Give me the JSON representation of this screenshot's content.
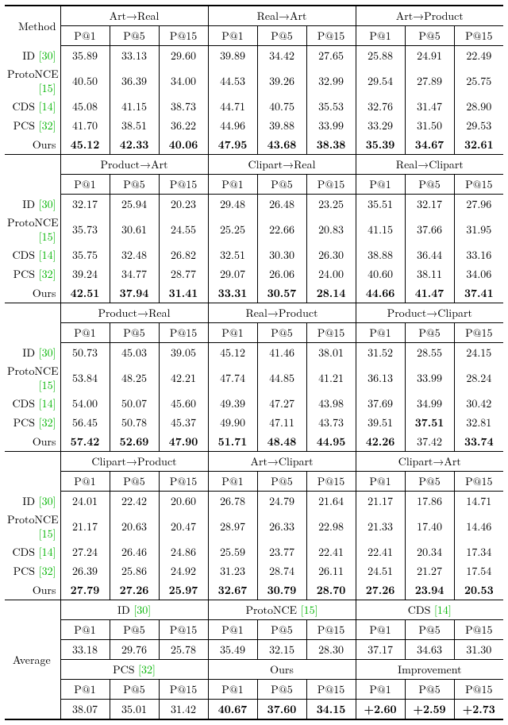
{
  "chart_data": {
    "type": "table",
    "title": "Cross-domain retrieval P@K results",
    "methods": [
      "ID [30]",
      "ProtoNCE [15]",
      "CDS [14]",
      "PCS [32]",
      "Ours"
    ],
    "metrics": [
      "P@1",
      "P@5",
      "P@15"
    ],
    "tasks": {
      "Art→Real": {
        "ID": [
          35.89,
          33.13,
          29.6
        ],
        "ProtoNCE": [
          40.5,
          36.39,
          34.0
        ],
        "CDS": [
          45.08,
          41.15,
          38.73
        ],
        "PCS": [
          41.7,
          38.51,
          36.22
        ],
        "Ours": [
          45.12,
          42.33,
          40.06
        ]
      },
      "Real→Art": {
        "ID": [
          39.89,
          34.42,
          27.65
        ],
        "ProtoNCE": [
          44.53,
          39.26,
          32.99
        ],
        "CDS": [
          44.71,
          40.75,
          35.53
        ],
        "PCS": [
          44.96,
          39.88,
          33.99
        ],
        "Ours": [
          47.95,
          43.68,
          38.38
        ]
      },
      "Art→Product": {
        "ID": [
          25.88,
          24.91,
          22.49
        ],
        "ProtoNCE": [
          29.54,
          27.89,
          25.75
        ],
        "CDS": [
          32.76,
          31.47,
          28.9
        ],
        "PCS": [
          33.29,
          31.5,
          29.53
        ],
        "Ours": [
          35.39,
          34.67,
          32.61
        ]
      },
      "Product→Art": {
        "ID": [
          32.17,
          25.94,
          20.23
        ],
        "ProtoNCE": [
          35.73,
          30.61,
          24.55
        ],
        "CDS": [
          35.75,
          32.48,
          26.82
        ],
        "PCS": [
          39.24,
          34.77,
          28.77
        ],
        "Ours": [
          42.51,
          37.94,
          31.41
        ]
      },
      "Clipart→Real": {
        "ID": [
          29.48,
          26.48,
          23.25
        ],
        "ProtoNCE": [
          25.25,
          22.66,
          20.83
        ],
        "CDS": [
          32.51,
          30.3,
          26.3
        ],
        "PCS": [
          29.07,
          26.06,
          24.0
        ],
        "Ours": [
          33.31,
          30.57,
          28.14
        ]
      },
      "Real→Clipart": {
        "ID": [
          35.51,
          32.17,
          27.96
        ],
        "ProtoNCE": [
          41.15,
          37.66,
          31.95
        ],
        "CDS": [
          38.88,
          36.44,
          33.16
        ],
        "PCS": [
          40.6,
          38.11,
          34.06
        ],
        "Ours": [
          44.66,
          41.47,
          37.41
        ]
      },
      "Product→Real": {
        "ID": [
          50.73,
          45.03,
          39.05
        ],
        "ProtoNCE": [
          53.84,
          48.25,
          42.21
        ],
        "CDS": [
          54.0,
          50.07,
          45.6
        ],
        "PCS": [
          56.45,
          50.78,
          45.37
        ],
        "Ours": [
          57.42,
          52.69,
          47.9
        ]
      },
      "Real→Product": {
        "ID": [
          45.12,
          41.46,
          38.01
        ],
        "ProtoNCE": [
          47.74,
          44.85,
          41.21
        ],
        "CDS": [
          49.39,
          47.27,
          43.98
        ],
        "PCS": [
          49.9,
          47.11,
          43.73
        ],
        "Ours": [
          51.71,
          48.48,
          44.95
        ]
      },
      "Product→Clipart": {
        "ID": [
          31.52,
          28.55,
          24.15
        ],
        "ProtoNCE": [
          36.13,
          33.99,
          28.24
        ],
        "CDS": [
          37.69,
          34.99,
          30.42
        ],
        "PCS": [
          39.51,
          37.51,
          32.81
        ],
        "Ours": [
          42.26,
          37.42,
          33.74
        ]
      },
      "Clipart→Product": {
        "ID": [
          24.01,
          22.42,
          20.6
        ],
        "ProtoNCE": [
          21.17,
          20.63,
          20.47
        ],
        "CDS": [
          27.24,
          26.46,
          24.86
        ],
        "PCS": [
          26.39,
          25.86,
          24.92
        ],
        "Ours": [
          27.79,
          27.26,
          25.97
        ]
      },
      "Art→Clipart": {
        "ID": [
          26.78,
          24.79,
          21.64
        ],
        "ProtoNCE": [
          28.97,
          26.33,
          22.98
        ],
        "CDS": [
          25.59,
          23.77,
          22.41
        ],
        "PCS": [
          31.23,
          28.74,
          26.11
        ],
        "Ours": [
          32.67,
          30.79,
          28.7
        ]
      },
      "Clipart→Art": {
        "ID": [
          21.17,
          17.86,
          14.71
        ],
        "ProtoNCE": [
          21.33,
          17.4,
          14.46
        ],
        "CDS": [
          22.41,
          20.34,
          17.34
        ],
        "PCS": [
          24.51,
          21.27,
          17.54
        ],
        "Ours": [
          27.26,
          23.94,
          20.53
        ]
      }
    },
    "averages": {
      "ID": [
        33.18,
        29.76,
        25.78
      ],
      "ProtoNCE": [
        35.49,
        32.15,
        28.3
      ],
      "CDS": [
        37.17,
        34.63,
        31.3
      ],
      "PCS": [
        38.07,
        35.01,
        31.42
      ],
      "Ours": [
        40.67,
        37.6,
        34.15
      ],
      "Improvement": [
        "+2.60",
        "+2.59",
        "+2.73"
      ]
    }
  },
  "hdr": {
    "method": "Method",
    "p1": "P@1",
    "p5": "P@5",
    "p15": "P@15",
    "avg": "Average",
    "improvement": "Improvement",
    "task1a": "Art→Real",
    "task1b": "Real→Art",
    "task1c": "Art→Product",
    "task2a": "Product→Art",
    "task2b": "Clipart→Real",
    "task2c": "Real→Clipart",
    "task3a": "Product→Real",
    "task3b": "Real→Product",
    "task3c": "Product→Clipart",
    "task4a": "Clipart→Product",
    "task4b": "Art→Clipart",
    "task4c": "Clipart→Art"
  },
  "m": {
    "id": {
      "name": "ID ",
      "ref": "[30]"
    },
    "pn": {
      "name": "ProtoNCE ",
      "ref": "[15]"
    },
    "cds": {
      "name": "CDS ",
      "ref": "[14]"
    },
    "pcs": {
      "name": "PCS ",
      "ref": "[32]"
    },
    "ours": {
      "name": "Ours"
    }
  },
  "b1": {
    "id": {
      "a1": "35.89",
      "a2": "33.13",
      "a3": "29.60",
      "b1": "39.89",
      "b2": "34.42",
      "b3": "27.65",
      "c1": "25.88",
      "c2": "24.91",
      "c3": "22.49"
    },
    "pn": {
      "a1": "40.50",
      "a2": "36.39",
      "a3": "34.00",
      "b1": "44.53",
      "b2": "39.26",
      "b3": "32.99",
      "c1": "29.54",
      "c2": "27.89",
      "c3": "25.75"
    },
    "cds": {
      "a1": "45.08",
      "a2": "41.15",
      "a3": "38.73",
      "b1": "44.71",
      "b2": "40.75",
      "b3": "35.53",
      "c1": "32.76",
      "c2": "31.47",
      "c3": "28.90"
    },
    "pcs": {
      "a1": "41.70",
      "a2": "38.51",
      "a3": "36.22",
      "b1": "44.96",
      "b2": "39.88",
      "b3": "33.99",
      "c1": "33.29",
      "c2": "31.50",
      "c3": "29.53"
    },
    "ours": {
      "a1": "45.12",
      "a2": "42.33",
      "a3": "40.06",
      "b1": "47.95",
      "b2": "43.68",
      "b3": "38.38",
      "c1": "35.39",
      "c2": "34.67",
      "c3": "32.61"
    }
  },
  "b2": {
    "id": {
      "a1": "32.17",
      "a2": "25.94",
      "a3": "20.23",
      "b1": "29.48",
      "b2": "26.48",
      "b3": "23.25",
      "c1": "35.51",
      "c2": "32.17",
      "c3": "27.96"
    },
    "pn": {
      "a1": "35.73",
      "a2": "30.61",
      "a3": "24.55",
      "b1": "25.25",
      "b2": "22.66",
      "b3": "20.83",
      "c1": "41.15",
      "c2": "37.66",
      "c3": "31.95"
    },
    "cds": {
      "a1": "35.75",
      "a2": "32.48",
      "a3": "26.82",
      "b1": "32.51",
      "b2": "30.30",
      "b3": "26.30",
      "c1": "38.88",
      "c2": "36.44",
      "c3": "33.16"
    },
    "pcs": {
      "a1": "39.24",
      "a2": "34.77",
      "a3": "28.77",
      "b1": "29.07",
      "b2": "26.06",
      "b3": "24.00",
      "c1": "40.60",
      "c2": "38.11",
      "c3": "34.06"
    },
    "ours": {
      "a1": "42.51",
      "a2": "37.94",
      "a3": "31.41",
      "b1": "33.31",
      "b2": "30.57",
      "b3": "28.14",
      "c1": "44.66",
      "c2": "41.47",
      "c3": "37.41"
    }
  },
  "b3": {
    "id": {
      "a1": "50.73",
      "a2": "45.03",
      "a3": "39.05",
      "b1": "45.12",
      "b2": "41.46",
      "b3": "38.01",
      "c1": "31.52",
      "c2": "28.55",
      "c3": "24.15"
    },
    "pn": {
      "a1": "53.84",
      "a2": "48.25",
      "a3": "42.21",
      "b1": "47.74",
      "b2": "44.85",
      "b3": "41.21",
      "c1": "36.13",
      "c2": "33.99",
      "c3": "28.24"
    },
    "cds": {
      "a1": "54.00",
      "a2": "50.07",
      "a3": "45.60",
      "b1": "49.39",
      "b2": "47.27",
      "b3": "43.98",
      "c1": "37.69",
      "c2": "34.99",
      "c3": "30.42"
    },
    "pcs": {
      "a1": "56.45",
      "a2": "50.78",
      "a3": "45.37",
      "b1": "49.90",
      "b2": "47.11",
      "b3": "43.73",
      "c1": "39.51",
      "c2": "37.51",
      "c3": "32.81"
    },
    "ours": {
      "a1": "57.42",
      "a2": "52.69",
      "a3": "47.90",
      "b1": "51.71",
      "b2": "48.48",
      "b3": "44.95",
      "c1": "42.26",
      "c2": "37.42",
      "c3": "33.74"
    }
  },
  "b4": {
    "id": {
      "a1": "24.01",
      "a2": "22.42",
      "a3": "20.60",
      "b1": "26.78",
      "b2": "24.79",
      "b3": "21.64",
      "c1": "21.17",
      "c2": "17.86",
      "c3": "14.71"
    },
    "pn": {
      "a1": "21.17",
      "a2": "20.63",
      "a3": "20.47",
      "b1": "28.97",
      "b2": "26.33",
      "b3": "22.98",
      "c1": "21.33",
      "c2": "17.40",
      "c3": "14.46"
    },
    "cds": {
      "a1": "27.24",
      "a2": "26.46",
      "a3": "24.86",
      "b1": "25.59",
      "b2": "23.77",
      "b3": "22.41",
      "c1": "22.41",
      "c2": "20.34",
      "c3": "17.34"
    },
    "pcs": {
      "a1": "26.39",
      "a2": "25.86",
      "a3": "24.92",
      "b1": "31.23",
      "b2": "28.74",
      "b3": "26.11",
      "c1": "24.51",
      "c2": "21.27",
      "c3": "17.54"
    },
    "ours": {
      "a1": "27.79",
      "a2": "27.26",
      "a3": "25.97",
      "b1": "32.67",
      "b2": "30.79",
      "b3": "28.70",
      "c1": "27.26",
      "c2": "23.94",
      "c3": "20.53"
    }
  },
  "avg": {
    "id": {
      "p1": "33.18",
      "p5": "29.76",
      "p15": "25.78"
    },
    "pn": {
      "p1": "35.49",
      "p5": "32.15",
      "p15": "28.30"
    },
    "cds": {
      "p1": "37.17",
      "p5": "34.63",
      "p15": "31.30"
    },
    "pcs": {
      "p1": "38.07",
      "p5": "35.01",
      "p15": "31.42"
    },
    "ours": {
      "p1": "40.67",
      "p5": "37.60",
      "p15": "34.15"
    },
    "imp": {
      "p1": "+2.60",
      "p5": "+2.59",
      "p15": "+2.73"
    }
  }
}
